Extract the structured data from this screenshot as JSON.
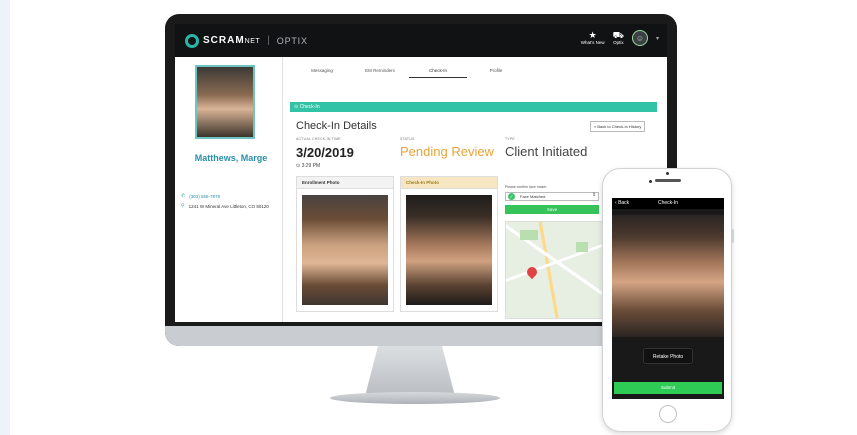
{
  "header": {
    "brand": "SCRAM",
    "brand_small": "NET",
    "separator": "|",
    "product": "OPTIX",
    "whats_new": "What's New",
    "optix_btn": "Optix"
  },
  "profile": {
    "name": "Matthews, Marge",
    "phone": "(303) 555-7878",
    "address": "1241 W Mineral Ave Littleton, CO 80120"
  },
  "tabs": [
    {
      "label": "Messaging"
    },
    {
      "label": "EM Reminders"
    },
    {
      "label": "Check-In"
    },
    {
      "label": "Profile"
    }
  ],
  "checkin": {
    "section_bar": "Check-In",
    "title": "Check-In Details",
    "back_button": "Back to Check-In History",
    "actual_label": "ACTUAL CHECK-IN TIME",
    "date": "3/20/2019",
    "time": "3:29 PM",
    "status_label": "STATUS",
    "status": "Pending Review",
    "type_label": "TYPE",
    "type": "Client Initiated",
    "enrollment_photo": "Enrollment Photo",
    "checkin_photo": "Check-In Photo",
    "confirm_label": "Please confirm face match:",
    "face_select": "Face Matched",
    "save": "Save"
  },
  "phone": {
    "back": "Back",
    "title": "Check-In",
    "retake": "Retake Photo",
    "submit": "Submit"
  },
  "colors": {
    "accent_teal": "#32c3a6",
    "status_orange": "#e8a33a",
    "name_blue": "#2a8fa8",
    "button_green": "#35c35a"
  }
}
